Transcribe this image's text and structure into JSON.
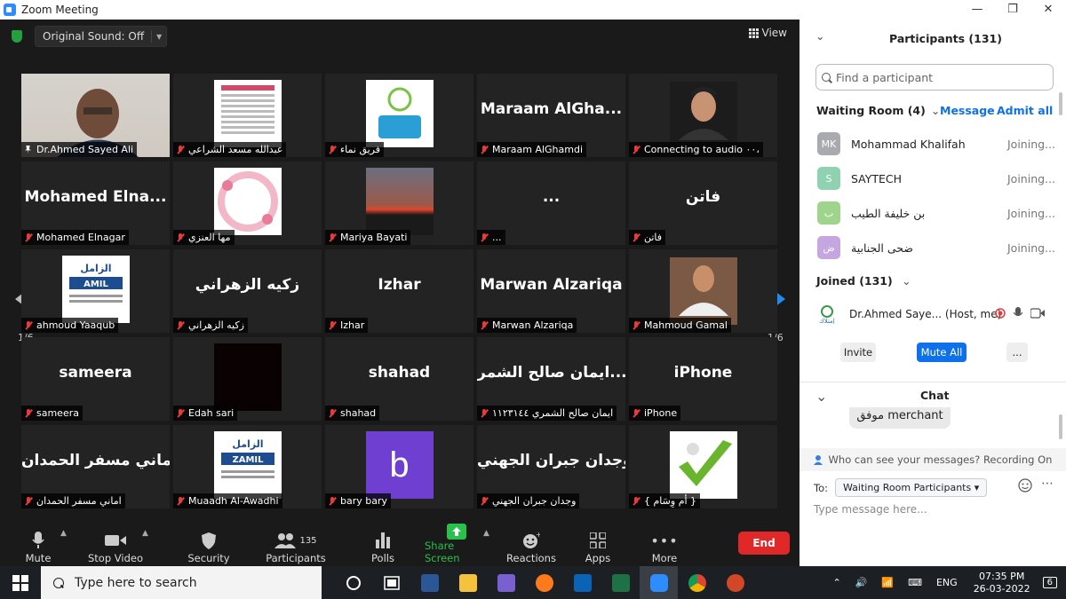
{
  "window": {
    "title": "Zoom Meeting",
    "controls": [
      "—",
      "❐",
      "✕"
    ]
  },
  "topbar": {
    "original_sound": "Original Sound: Off",
    "view": "View"
  },
  "pager": {
    "left": "1/6",
    "right": "1/6"
  },
  "tiles": [
    {
      "name": "Dr.Ahmed  Sayed Ali",
      "pinned": true,
      "video": "person"
    },
    {
      "name": "عبدالله مسعد الشراعي",
      "video": "doc"
    },
    {
      "name": "فريق نماء",
      "video": "logo"
    },
    {
      "name": "Maraam AlGhamdi",
      "big": "Maraam  AlGha..."
    },
    {
      "name": "Connecting to audio ٠٠،",
      "video": "portrait"
    },
    {
      "name": "Mohamed  Elnagar",
      "big": "Mohamed   Elna..."
    },
    {
      "name": "مها العنزي",
      "video": "flower"
    },
    {
      "name": "Mariya Bayati",
      "video": "sunset"
    },
    {
      "name": "...",
      "big": "..."
    },
    {
      "name": "فاتن",
      "big": "فاتن"
    },
    {
      "name": "ahmoud Yaaqub",
      "video": "zamil1"
    },
    {
      "name": "زكيه الزهراني",
      "big": "زكيه الزهراني"
    },
    {
      "name": "Izhar",
      "big": "Izhar"
    },
    {
      "name": "Marwan Alzariqa",
      "big": "Marwan Alzariqa"
    },
    {
      "name": "Mahmoud Gamal",
      "video": "man"
    },
    {
      "name": "sameera",
      "big": "sameera"
    },
    {
      "name": "Edah sari",
      "video": "dark"
    },
    {
      "name": "shahad",
      "big": "shahad"
    },
    {
      "name": "ايمان صالح الشمري ١١٢٣١٤٤",
      "big": "ايمان صالح الشمر..."
    },
    {
      "name": "iPhone",
      "big": "iPhone"
    },
    {
      "name": "اماني مسفر الحمدان",
      "big": "اماني مسفر الحمدان"
    },
    {
      "name": "Muaadh Al-Awadhi",
      "video": "zamil2"
    },
    {
      "name": "bary bary",
      "video": "b"
    },
    {
      "name": "وجدان جبران الجهني",
      "big": "وجدان جبران الجهني"
    },
    {
      "name": "{ أم وِسَام }",
      "video": "check"
    }
  ],
  "toolbar": {
    "mute": "Mute",
    "stop_video": "Stop Video",
    "security": "Security",
    "participants": "Participants",
    "participants_count": "135",
    "polls": "Polls",
    "share_screen": "Share Screen",
    "reactions": "Reactions",
    "apps": "Apps",
    "more": "More",
    "end": "End"
  },
  "panel": {
    "title": "Participants (131)",
    "search_placeholder": "Find a participant",
    "waiting_room": "Waiting Room (4)",
    "message": "Message",
    "admit_all": "Admit all",
    "waiting": [
      {
        "initials": "MK",
        "name": "Mohammad Khalifah",
        "status": "Joining...",
        "color": "#a8aab0"
      },
      {
        "initials": "S",
        "name": "SAYTECH",
        "status": "Joining...",
        "color": "#8fd1b0"
      },
      {
        "initials": "ب",
        "name": "بن خليفة الطيب",
        "status": "Joining...",
        "color": "#9fd48d"
      },
      {
        "initials": "ض",
        "name": "ضحى الجنابية",
        "status": "Joining...",
        "color": "#c6a6e0"
      }
    ],
    "joined": "Joined (131)",
    "host": {
      "name": "Dr.Ahmed  Saye... (Host, me)"
    },
    "invite": "Invite",
    "mute_all": "Mute All",
    "more": "...",
    "chat": {
      "title": "Chat",
      "bubble": "موفق merchant",
      "notice": "Who can see your messages? Recording On",
      "to_label": "To:",
      "to_value": "Waiting Room Participants",
      "placeholder": "Type message here..."
    }
  },
  "taskbar": {
    "search": "Type here to search",
    "lang": "ENG",
    "time": "07:35 PM",
    "date": "26-03-2022",
    "notif": "6"
  }
}
